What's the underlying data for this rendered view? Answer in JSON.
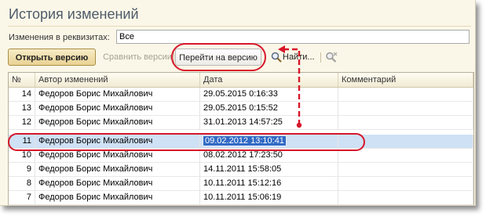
{
  "window": {
    "title": "История изменений"
  },
  "filter": {
    "label": "Изменения в реквизитах:",
    "value": "Все"
  },
  "toolbar": {
    "open_version": "Открыть версию",
    "compare_versions": "Сравнить версии",
    "goto_version": "Перейти на версию",
    "find": "Найти...",
    "find_icon": "magnifier-icon",
    "clear_search_icon": "magnifier-cancel-icon"
  },
  "table": {
    "columns": [
      "№",
      "Автор изменений",
      "Дата",
      "Комментарий"
    ],
    "rows": [
      {
        "num": "14",
        "author": "Федоров Борис Михайлович",
        "date": "29.05.2015 0:16:33",
        "comment": ""
      },
      {
        "num": "13",
        "author": "Федоров Борис Михайлович",
        "date": "29.05.2015 0:15:52",
        "comment": ""
      },
      {
        "num": "12",
        "author": "Федоров Борис Михайлович",
        "date": "31.01.2013 14:57:25",
        "comment": ""
      },
      {
        "num": "11",
        "author": "Федоров Борис Михайлович",
        "date": "09.02.2012 13:10:41",
        "comment": ""
      },
      {
        "num": "10",
        "author": "Федоров Борис Михайлович",
        "date": "08.02.2012 17:23:50",
        "comment": ""
      },
      {
        "num": "9",
        "author": "Федоров Борис Михайлович",
        "date": "14.11.2011 15:58:05",
        "comment": ""
      },
      {
        "num": "8",
        "author": "Федоров Борис Михайлович",
        "date": "10.11.2011 15:12:16",
        "comment": ""
      },
      {
        "num": "7",
        "author": "Федоров Борис Михайлович",
        "date": "10.11.2011 15:06:19",
        "comment": ""
      }
    ],
    "selected_row": "11"
  },
  "colors": {
    "highlight": "#d7172a",
    "selection": "#316ac5",
    "accent": "#e9d292"
  }
}
